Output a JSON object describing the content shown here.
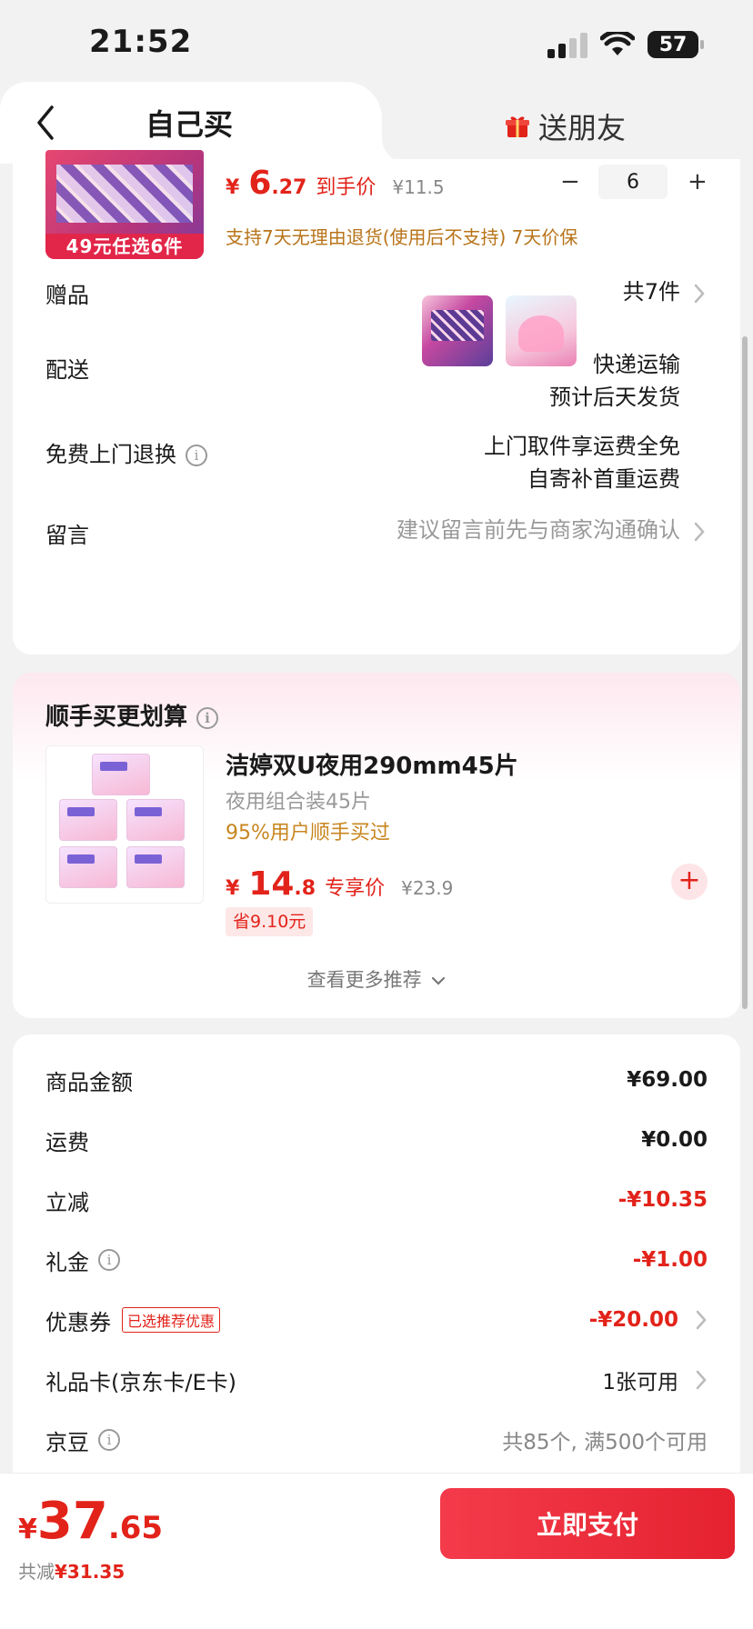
{
  "status_bar": {
    "time": "21:52",
    "battery": "57"
  },
  "tabs": {
    "self": "自己买",
    "gift": "送朋友"
  },
  "product": {
    "thumb_promo": "49元任选6件",
    "price_int": "6",
    "price_dec": ".27",
    "price_tag": "到手价",
    "price_orig": "¥11.5",
    "quantity": "6",
    "service": "支持7天无理由退货(使用后不支持) 7天价保"
  },
  "rows": {
    "gift_label": "赠品",
    "gift_count": "共7件",
    "delivery_label": "配送",
    "delivery_line1": "快递运输",
    "delivery_line2": "预计后天发货",
    "return_label": "免费上门退换",
    "return_line1": "上门取件享运费全免",
    "return_line2": "自寄补首重运费",
    "message_label": "留言",
    "message_placeholder": "建议留言前先与商家沟通确认"
  },
  "reco": {
    "title": "顺手买更划算",
    "name": "洁婷双U夜用290mm45片",
    "sub": "夜用组合装45片",
    "social": "95%用户顺手买过",
    "price_int": "14",
    "price_dec": ".8",
    "price_tag": "专享价",
    "price_orig": "¥23.9",
    "save": "省9.10元",
    "see_more": "查看更多推荐"
  },
  "summary": {
    "goods_label": "商品金额",
    "goods_value": "¥69.00",
    "shipping_label": "运费",
    "shipping_value": "¥0.00",
    "discount_label": "立减",
    "discount_value": "-¥10.35",
    "cash_label": "礼金",
    "cash_value": "-¥1.00",
    "coupon_label": "优惠券",
    "coupon_badge": "已选推荐优惠",
    "coupon_value": "-¥20.00",
    "giftcard_label": "礼品卡(京东卡/E卡)",
    "giftcard_value": "1张可用",
    "beans_label": "京豆",
    "beans_value": "共85个, 满500个可用"
  },
  "footer": {
    "yen": "¥",
    "total_int": "37",
    "total_dec": ".65",
    "reduce_label": "共减",
    "reduce_value": "¥31.35",
    "pay_label": "立即支付"
  },
  "colors": {
    "accent": "#e2231a",
    "service": "#b8741a",
    "pay_start": "#f43b4b"
  }
}
